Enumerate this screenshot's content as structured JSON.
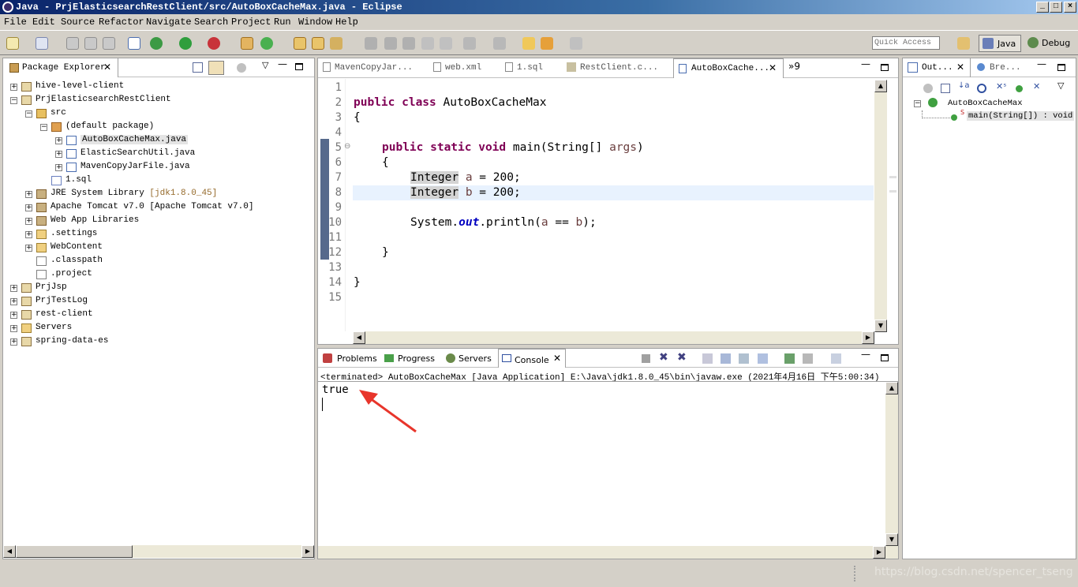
{
  "window": {
    "title": "Java - PrjElasticsearchRestClient/src/AutoBoxCacheMax.java - Eclipse",
    "min": "_",
    "max": "□",
    "close": "×"
  },
  "menu": [
    "File",
    "Edit",
    "Source",
    "Refactor",
    "Navigate",
    "Search",
    "Project",
    "Run",
    "Window",
    "Help"
  ],
  "toolbar": {
    "quick_access_placeholder": "Quick Access",
    "persp_java": "Java",
    "persp_debug": "Debug"
  },
  "package_explorer": {
    "title": "Package Explorer",
    "items": [
      {
        "label": "hive-level-client"
      },
      {
        "label": "PrjElasticsearchRestClient"
      },
      {
        "label": "src"
      },
      {
        "label": "(default package)"
      },
      {
        "label": "AutoBoxCacheMax.java"
      },
      {
        "label": "ElasticSearchUtil.java"
      },
      {
        "label": "MavenCopyJarFile.java"
      },
      {
        "label": "1.sql"
      },
      {
        "label": "JRE System Library",
        "suffix": "[jdk1.8.0_45]"
      },
      {
        "label": "Apache Tomcat v7.0 [Apache Tomcat v7.0]"
      },
      {
        "label": "Web App Libraries"
      },
      {
        "label": ".settings"
      },
      {
        "label": "WebContent"
      },
      {
        "label": ".classpath"
      },
      {
        "label": ".project"
      },
      {
        "label": "PrjJsp"
      },
      {
        "label": "PrjTestLog"
      },
      {
        "label": "rest-client"
      },
      {
        "label": "Servers"
      },
      {
        "label": "spring-data-es"
      }
    ]
  },
  "editor": {
    "tabs": [
      "MavenCopyJar...",
      "web.xml",
      "1.sql",
      "RestClient.c...",
      "AutoBoxCache..."
    ],
    "overflow": "»9",
    "lines": [
      "1",
      "2",
      "3",
      "4",
      "5",
      "6",
      "7",
      "8",
      "9",
      "10",
      "11",
      "12",
      "13",
      "14",
      "15"
    ],
    "code": {
      "l2a": "public class",
      "l2b": " AutoBoxCacheMax",
      "l3": "{",
      "l5a": "public static void",
      "l5b": " main(String[] ",
      "l5c": "args",
      ")": ")",
      "l6": "{",
      "l7a": "Integer",
      "l7b": " ",
      "l7c": "a",
      " l7d": " = 200;",
      "l8a": "Integer",
      "l8b": " ",
      "l8c": "b",
      "l8d": " = 200;",
      "l10a": "System.",
      "l10b": "out",
      "l10c": ".println(",
      "l10d": "a",
      " l10e": " == ",
      "l10f": "b",
      "l10g": ");",
      "l12": "}",
      "l14": "}"
    }
  },
  "outline": {
    "tabs": [
      "Out...",
      "Bre..."
    ],
    "class": "AutoBoxCacheMax",
    "method": "main(String[]) : void"
  },
  "console": {
    "tabs": [
      "Problems",
      "Progress",
      "Servers",
      "Console"
    ],
    "header": "<terminated> AutoBoxCacheMax [Java Application] E:\\Java\\jdk1.8.0_45\\bin\\javaw.exe (2021年4月16日 下午5:00:34)",
    "output": "true"
  },
  "watermark": "https://blog.csdn.net/spencer_tseng",
  "colors": {
    "keyword": "#7f0055",
    "field": "#0000c0",
    "variable": "#6a3e3e",
    "selection_bar": "#c6c3bb",
    "arrow": "#e8352b"
  }
}
